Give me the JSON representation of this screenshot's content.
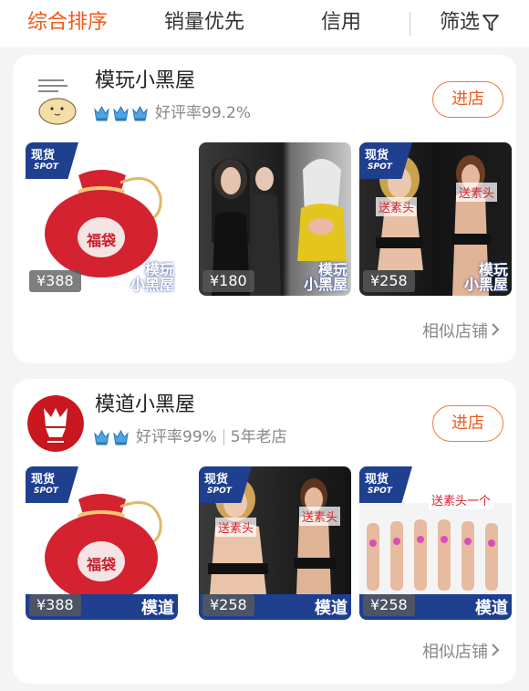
{
  "sort_bar": {
    "items": [
      {
        "label": "综合排序",
        "active": true
      },
      {
        "label": "销量优先",
        "active": false
      },
      {
        "label": "信用",
        "active": false
      }
    ],
    "filter_label": "筛选",
    "filter_icon": "funnel-icon",
    "accent_color": "#f05a1a"
  },
  "shops": [
    {
      "name": "模玩小黑屋",
      "avatar_icon": "cartoon-seal-avatar",
      "crown_count": 3,
      "rating": "好评率99.2%",
      "enter_label": "进店",
      "similar_label": "相似店铺",
      "products": [
        {
          "price": "¥388",
          "badge": {
            "cn": "现货",
            "en": "SPOT"
          },
          "image": "red-lucky-bag",
          "image_text": "福袋",
          "brand": [
            "模玩",
            "小黑屋"
          ]
        },
        {
          "price": "¥180",
          "badge": {
            "cn": "现货",
            "en": "SPOT"
          },
          "image": "figure-heads-photo",
          "image_text": "",
          "brand": [
            "模玩",
            "小黑屋"
          ]
        },
        {
          "price": "¥258",
          "badge": {
            "cn": "现货",
            "en": "SPOT"
          },
          "image": "body-figures-photo",
          "image_text": "送素头",
          "brand": [
            "模玩",
            "小黑屋"
          ]
        }
      ]
    },
    {
      "name": "模道小黑屋",
      "avatar_icon": "red-mask-logo-avatar",
      "crown_count": 2,
      "rating": "好评率99%",
      "shop_age": "5年老店",
      "enter_label": "进店",
      "similar_label": "相似店铺",
      "products": [
        {
          "price": "¥388",
          "badge": {
            "cn": "现货",
            "en": "SPOT"
          },
          "image": "red-lucky-bag",
          "image_text": "福袋",
          "brand": [
            "模道"
          ]
        },
        {
          "price": "¥258",
          "badge": {
            "cn": "现货",
            "en": "SPOT"
          },
          "image": "body-figures-photo",
          "image_text": "送素头",
          "brand": [
            "模道"
          ]
        },
        {
          "price": "¥258",
          "badge": {
            "cn": "现货",
            "en": "SPOT"
          },
          "image": "body-lineup-photo",
          "image_text": "送素头一个",
          "brand": [
            "模道"
          ]
        }
      ]
    }
  ]
}
